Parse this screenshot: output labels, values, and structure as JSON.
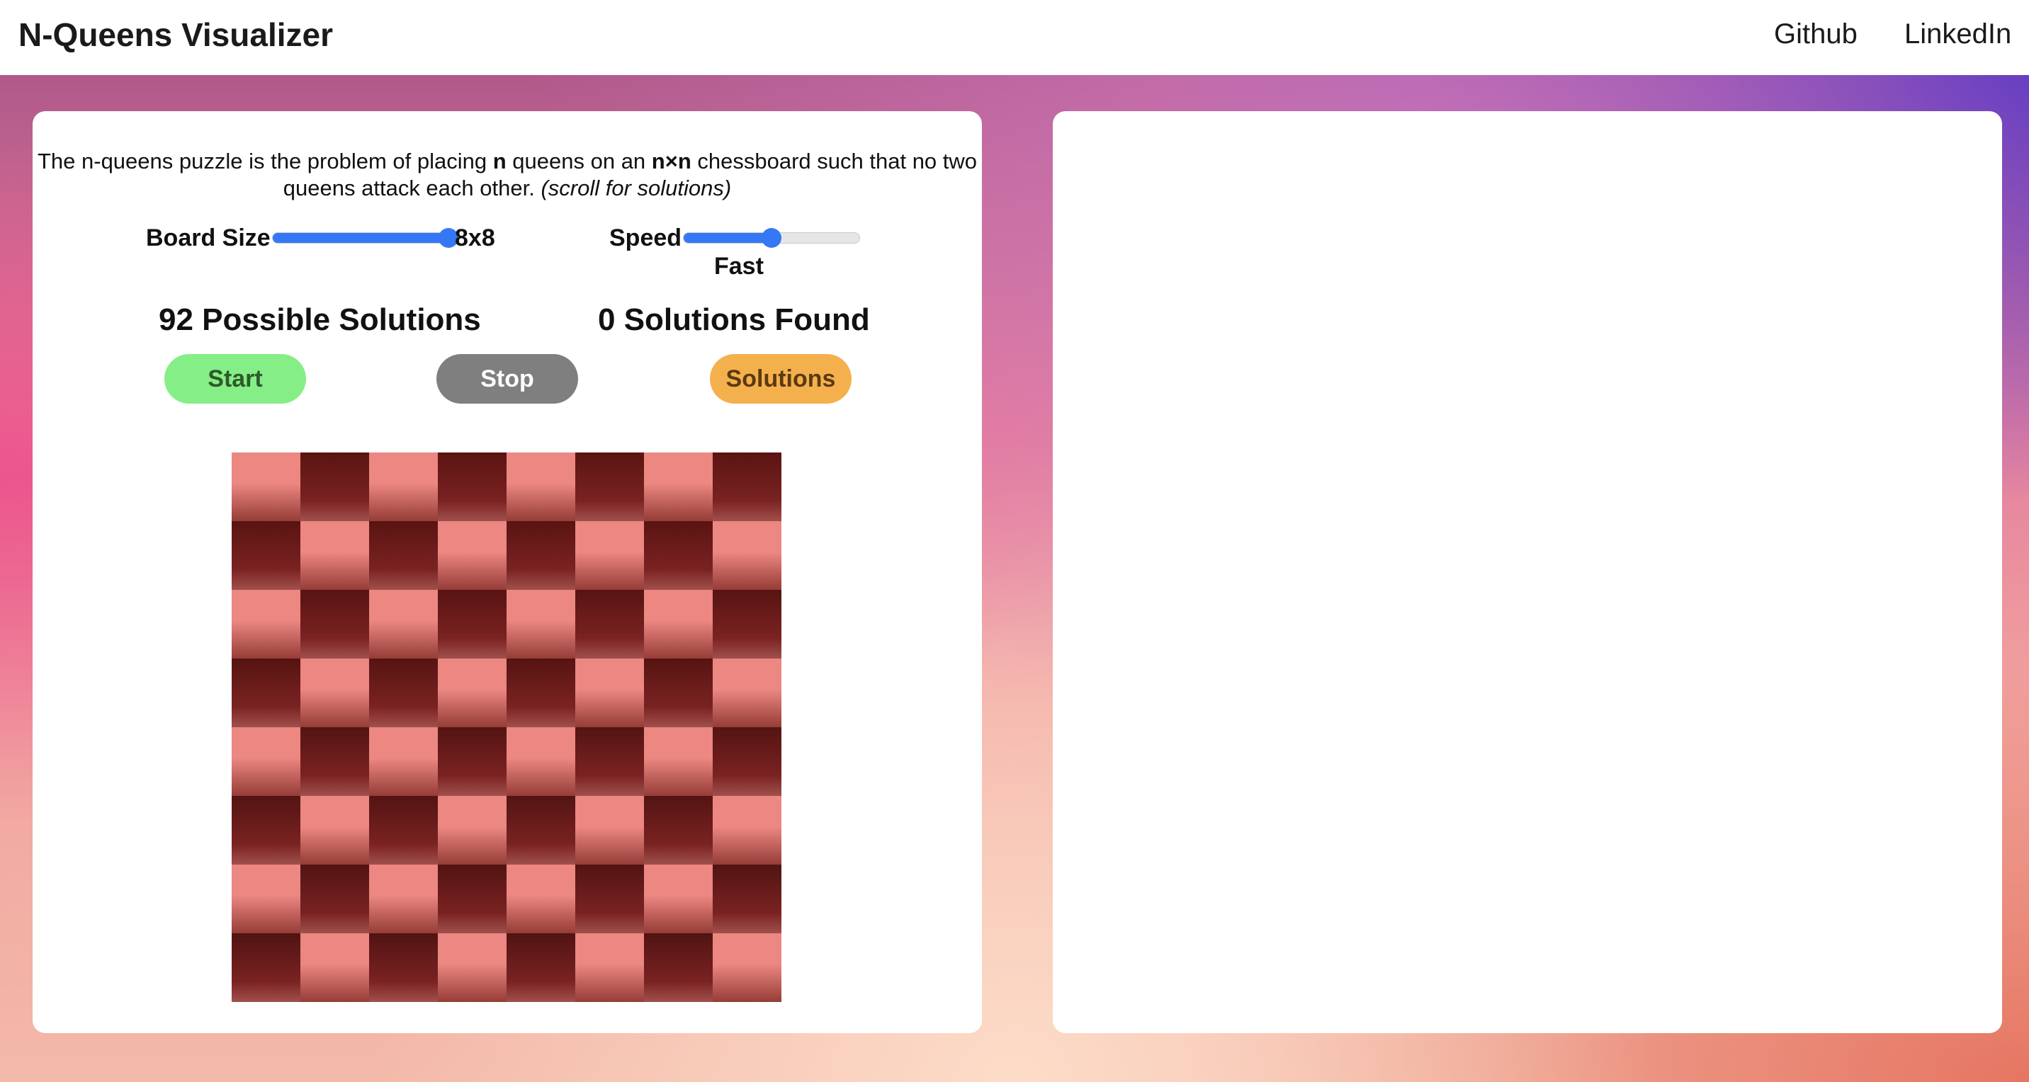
{
  "navbar": {
    "title": "N-Queens Visualizer",
    "links": [
      "Github",
      "LinkedIn"
    ]
  },
  "intro": {
    "part1": "The n-queens puzzle is the problem of placing ",
    "n": "n",
    "part2": " queens on an ",
    "nxn": "n×n",
    "part3": " chessboard such that no two queens attack each other. ",
    "hint": "(scroll for solutions)"
  },
  "controls": {
    "board_size_label": "Board Size",
    "board_size_value": "8x8",
    "board_size_level": 1.0,
    "speed_label": "Speed",
    "speed_value": "Fast",
    "speed_level": 0.5
  },
  "stats": {
    "possible": "92 Possible Solutions",
    "found": "0 Solutions Found"
  },
  "buttons": {
    "start": "Start",
    "stop": "Stop",
    "solutions": "Solutions"
  },
  "board": {
    "size": 8,
    "light_color": "#ec8782",
    "dark_color": "#7a2222"
  },
  "colors": {
    "slider_accent": "#3478f6",
    "start_bg": "#86ee86",
    "stop_bg": "#7f7f7f",
    "solutions_bg": "#f5b04e"
  }
}
